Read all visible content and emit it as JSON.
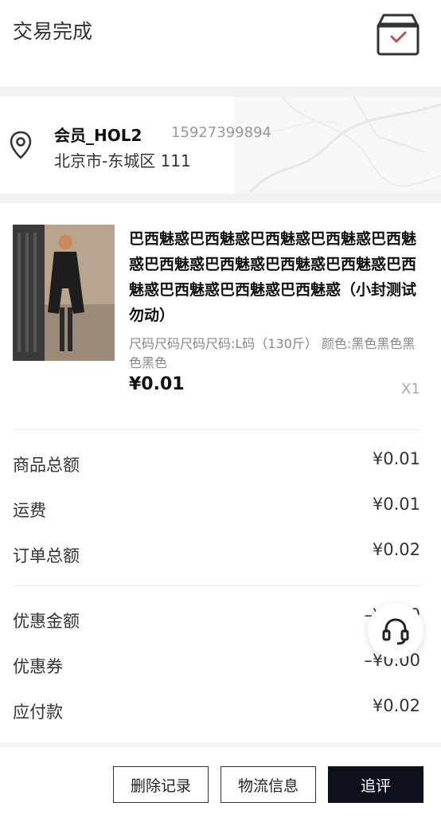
{
  "header": {
    "title": "交易完成",
    "icon": "package-icon"
  },
  "address": {
    "name": "会员_HOL2",
    "phone": "15927399894",
    "line": "北京市-东城区 111"
  },
  "product": {
    "title": "巴西魅惑巴西魅惑巴西魅惑巴西魅惑巴西魅惑巴西魅惑巴西魅惑巴西魅惑巴西魅惑巴西魅惑巴西魅惑巴西魅惑巴西魅惑（小封测试勿动）",
    "spec": "尺码尺码尺码尺码:L码（130斤） 颜色:黑色黑色黑色黑色",
    "price": "¥0.01",
    "qty": "X1"
  },
  "summary": [
    {
      "label": "商品总额",
      "value": "¥0.01"
    },
    {
      "label": "运费",
      "value": "¥0.01"
    },
    {
      "label": "订单总额",
      "value": "¥0.02"
    }
  ],
  "discounts": [
    {
      "label": "优惠金额",
      "value": "–¥0.00"
    },
    {
      "label": "优惠券",
      "value": "–¥0.00"
    },
    {
      "label": "应付款",
      "value": "¥0.02"
    }
  ],
  "actions": {
    "delete": "删除记录",
    "logistics": "物流信息",
    "review": "追评"
  },
  "colors": {
    "primary_dark": "#0e111b",
    "accent": "#c0504d"
  }
}
